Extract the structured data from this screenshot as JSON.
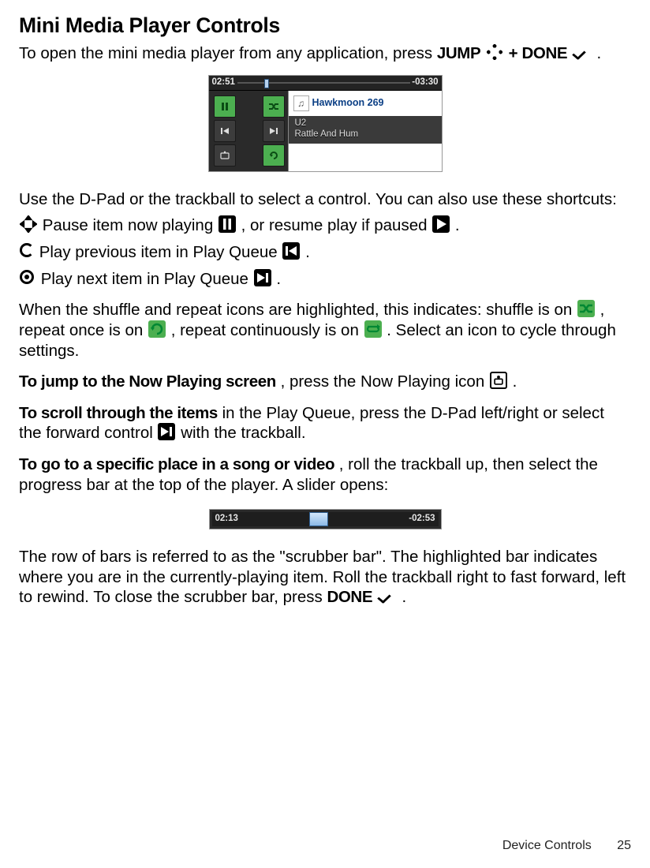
{
  "heading": "Mini Media Player Controls",
  "intro": {
    "pre": "To open the mini media player from any application, press ",
    "jump": "JUMP",
    "plus": " + ",
    "done": "DONE",
    "post": "."
  },
  "player": {
    "elapsed": "02:51",
    "remaining": "-03:30",
    "track_title": "Hawkmoon 269",
    "artist": "U2",
    "album": "Rattle And Hum"
  },
  "dpad_intro": "Use the D-Pad or the trackball to select a control. You can also use these shortcuts:",
  "bullets": {
    "pause_pre": " Pause item now playing ",
    "pause_mid": " , or resume play if paused ",
    "pause_post": ".",
    "prev": " Play previous item in Play Queue ",
    "prev_post": ".",
    "next": " Play next item in Play Queue ",
    "next_post": "."
  },
  "shuffle_text": {
    "a": "When the shuffle and repeat icons are highlighted, this indicates: shuffle is on ",
    "b": " , repeat once is on ",
    "c": " , repeat continuously is on ",
    "d": ". Select an icon to cycle through settings."
  },
  "nowplaying": {
    "bold": "To jump to the Now Playing screen",
    "rest": ", press the Now Playing icon ",
    "post": "."
  },
  "scroll": {
    "bold": "To scroll through the items",
    "rest_a": " in the Play Queue, press the D-Pad left/right or select the forward control ",
    "rest_b": " with the trackball."
  },
  "seek": {
    "bold": "To go to a specific place in a song or video",
    "rest": ", roll the trackball up, then select the progress bar at the top of the player. A slider opens:"
  },
  "scrubber": {
    "elapsed": "02:13",
    "remaining": "-02:53",
    "handle_left_pct": 43
  },
  "scrubber_para": {
    "a": "The row of bars is referred to as the \"scrubber bar\". The highlighted bar indicates where you are in the currently-playing item. Roll the trackball right to fast forward, left to rewind. To close the scrubber bar, press ",
    "done": "DONE",
    "b": "."
  },
  "footer": {
    "section": "Device Controls",
    "page": "25"
  }
}
